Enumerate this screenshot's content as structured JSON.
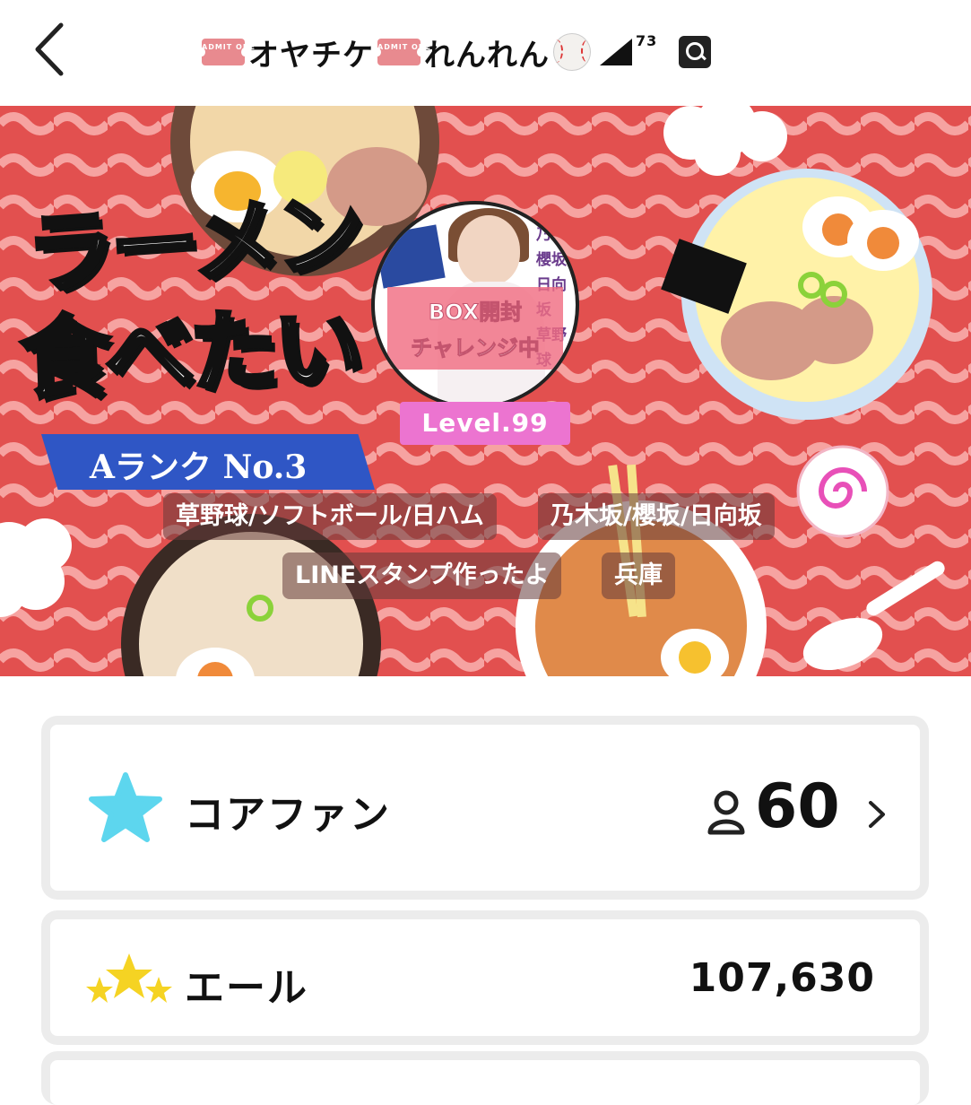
{
  "header": {
    "title_part1": "オヤチケ",
    "title_part2": "れんれん",
    "superscript": "73",
    "ticket_text": "ADMIT ONE"
  },
  "banner": {
    "title_line1": "ラーメン",
    "title_line2": "食べたい",
    "rank": "Aランク  No.3",
    "level": "Level.99",
    "avatar_panel_line1": "BOX開封",
    "avatar_panel_line2": "チャレンジ中",
    "avatar_side_words": [
      "乃木",
      "櫻坂",
      "日向坂",
      "草野球"
    ],
    "tags": [
      "草野球/ソフトボール/日ハム",
      "乃木坂/櫻坂/日向坂",
      "LINEスタンプ作ったよ",
      "兵庫"
    ]
  },
  "core_fan": {
    "label": "コアファン",
    "count": "60",
    "star_color": "#5dd6ee"
  },
  "yell": {
    "label": "エール",
    "value": "107,630",
    "star_color": "#f5d323"
  }
}
